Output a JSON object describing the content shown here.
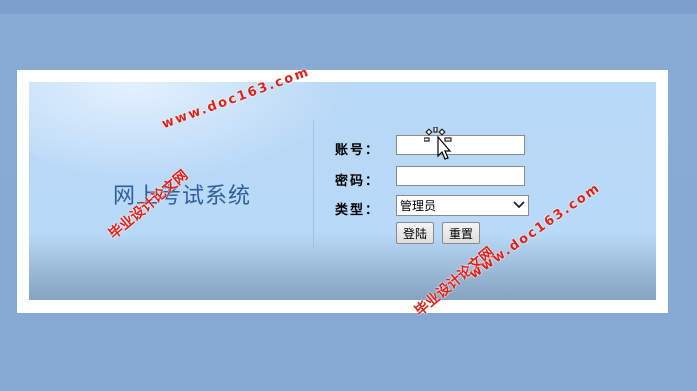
{
  "app": {
    "title": "网上考试系统"
  },
  "login": {
    "account_label": "账号：",
    "password_label": "密码：",
    "type_label": "类型：",
    "account_value": "",
    "password_value": "",
    "type_selected": "管理员",
    "login_button": "登陆",
    "reset_button": "重置"
  },
  "watermarks": [
    {
      "cn": "毕业设计论文网",
      "url": "www.doc163.com"
    },
    {
      "cn": "毕业设计论文网",
      "url": "www.doc163.com"
    }
  ],
  "icons": {
    "cursor": "busy-pointer-icon",
    "select_arrow": "chevron-down-icon"
  },
  "colors": {
    "title": "#2f5f9a",
    "watermark": "#e0201a",
    "frame": "#ffffff",
    "page_bg": "#86aad3"
  }
}
